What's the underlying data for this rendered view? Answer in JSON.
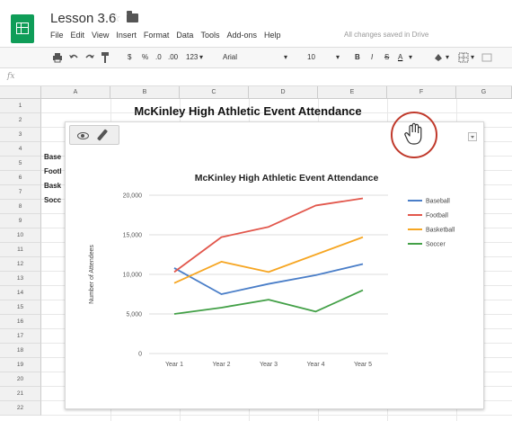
{
  "app": {
    "title": "Lesson 3.6",
    "menu": [
      "File",
      "Edit",
      "View",
      "Insert",
      "Format",
      "Data",
      "Tools",
      "Add-ons",
      "Help"
    ],
    "saved_status": "All changes saved in Drive"
  },
  "toolbar": {
    "currency": "$",
    "percent": "%",
    "decimal_less": ".0",
    "decimal_more": ".00",
    "number_format": "123",
    "font": "Arial",
    "font_size": "10",
    "bold": "B",
    "italic": "I",
    "strike": "S",
    "text_color": "A"
  },
  "formula_bar": {
    "fx": "fx"
  },
  "grid": {
    "columns": [
      "A",
      "B",
      "C",
      "D",
      "E",
      "F",
      "G"
    ],
    "rows": [
      "1",
      "2",
      "3",
      "4",
      "5",
      "6",
      "7",
      "8",
      "9",
      "10",
      "11",
      "12",
      "13",
      "14",
      "15",
      "16",
      "17",
      "18",
      "19",
      "20",
      "21",
      "22"
    ],
    "title_cell": "McKinley High Athletic Event Attendance",
    "visible_cells": [
      "Base",
      "Footl",
      "Bask",
      "Socc"
    ]
  },
  "chart_data": {
    "type": "line",
    "title": "McKinley High Athletic Event Attendance",
    "xlabel": "",
    "ylabel": "Number of Attendees",
    "categories": [
      "Year 1",
      "Year 2",
      "Year 3",
      "Year 4",
      "Year 5"
    ],
    "y_ticks": [
      "0",
      "5,000",
      "10,000",
      "15,000",
      "20,000"
    ],
    "ylim": [
      0,
      20000
    ],
    "grid": true,
    "legend_position": "right",
    "series": [
      {
        "name": "Baseball",
        "color": "#4a7ec8",
        "values": [
          10800,
          7500,
          8800,
          9900,
          11300
        ]
      },
      {
        "name": "Football",
        "color": "#e2574c",
        "values": [
          10300,
          14700,
          16000,
          18700,
          19600
        ]
      },
      {
        "name": "Basketball",
        "color": "#f6a623",
        "values": [
          8900,
          11600,
          10300,
          12500,
          14700
        ]
      },
      {
        "name": "Soccer",
        "color": "#43a047",
        "values": [
          5000,
          5800,
          6800,
          5300,
          8000
        ]
      }
    ]
  }
}
